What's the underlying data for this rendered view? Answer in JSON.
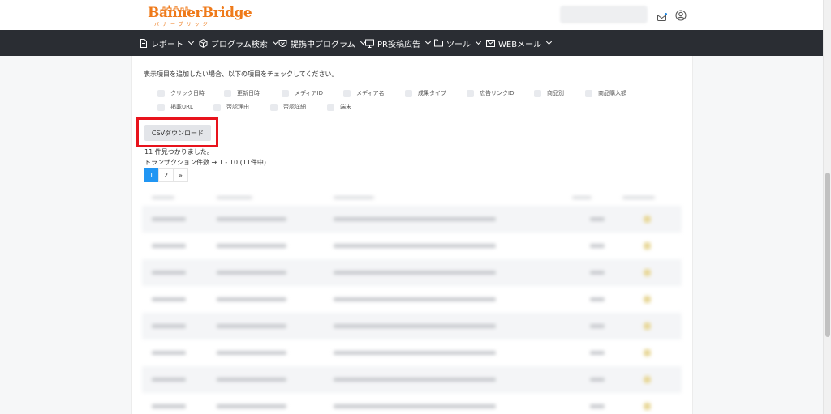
{
  "header": {
    "logo_text": "BannerBridge",
    "logo_sub": "バナーブリッジ"
  },
  "nav": {
    "items": [
      {
        "label": "レポート"
      },
      {
        "label": "プログラム検索"
      },
      {
        "label": "提携中プログラム"
      },
      {
        "label": "PR投稿広告"
      },
      {
        "label": "ツール"
      },
      {
        "label": "WEBメール"
      }
    ]
  },
  "main": {
    "intro_text": "表示項目を追加したい場合、以下の項目をチェックしてください。",
    "checkboxes": [
      {
        "label": "クリック日時"
      },
      {
        "label": "更新日時"
      },
      {
        "label": "メディアID"
      },
      {
        "label": "メディア名"
      },
      {
        "label": "成果タイプ"
      },
      {
        "label": "広告リンクID"
      },
      {
        "label": "商品別"
      },
      {
        "label": "商品購入額"
      },
      {
        "label": "掲載URL"
      },
      {
        "label": "否認理由"
      },
      {
        "label": "否認詳細"
      },
      {
        "label": "端末"
      }
    ],
    "csv_button": "CSVダウンロード",
    "found_text": "11 件見つかりました。",
    "range_text": "トランザクション件数 → 1 - 10 (11件中)",
    "pagination": [
      "1",
      "2",
      "»"
    ],
    "highlight_color": "#e8131c",
    "active_page_color": "#2196f3"
  }
}
